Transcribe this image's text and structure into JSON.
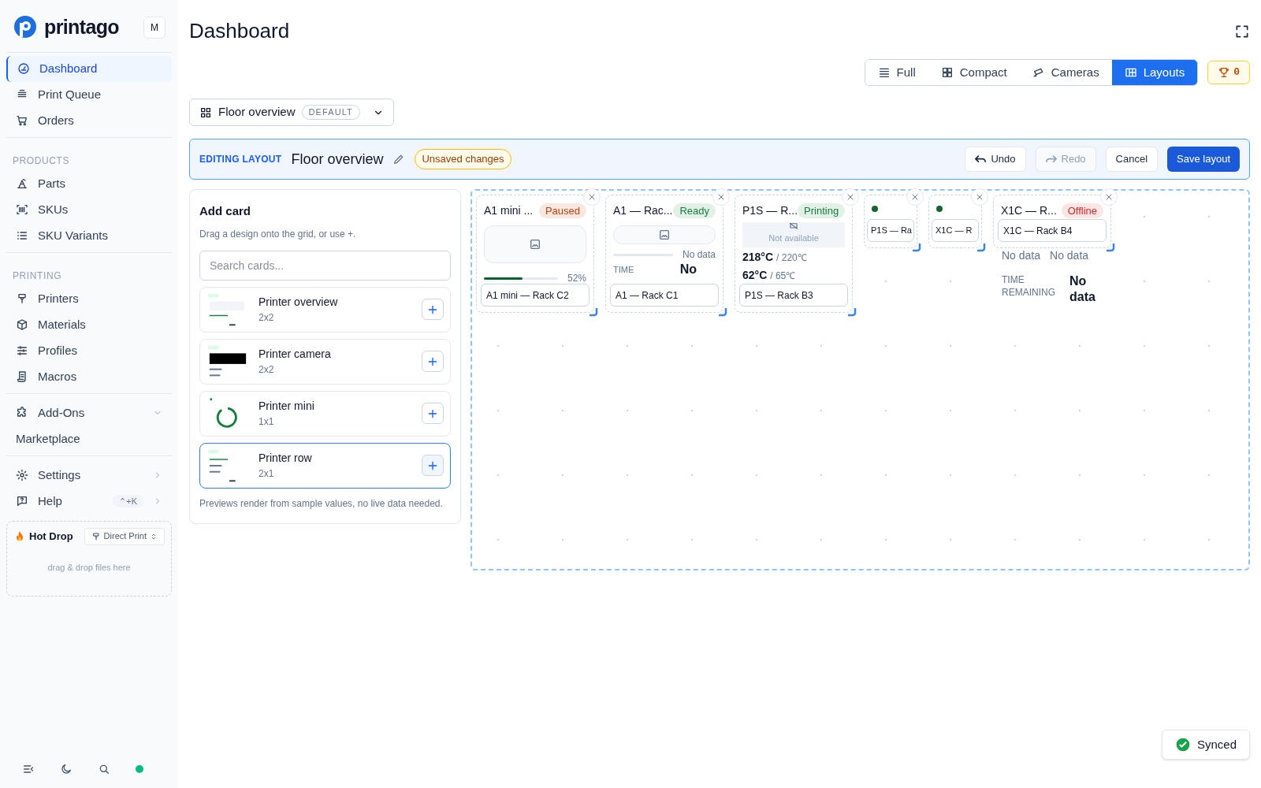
{
  "sidebar": {
    "brand": "printago",
    "avatar": "M",
    "sections": [
      {
        "items": [
          {
            "label": "Dashboard",
            "selected": true
          },
          {
            "label": "Print Queue",
            "selected": false
          },
          {
            "label": "Orders",
            "selected": false
          }
        ]
      },
      {
        "header": "PRODUCTS",
        "items": [
          {
            "label": "Parts",
            "selected": false
          },
          {
            "label": "SKUs",
            "selected": false
          },
          {
            "label": "SKU Variants",
            "selected": false
          }
        ]
      },
      {
        "header": "PRINTING",
        "items": [
          {
            "label": "Printers",
            "selected": false
          },
          {
            "label": "Materials",
            "selected": false
          },
          {
            "label": "Profiles",
            "selected": false
          },
          {
            "label": "Macros",
            "selected": false
          }
        ]
      },
      {
        "items": [
          {
            "label": "Add-Ons",
            "selected": false,
            "expanded": false
          },
          {
            "label": "Marketplace",
            "selected": false
          }
        ]
      },
      {
        "items": [
          {
            "label": "Settings",
            "selected": false
          },
          {
            "label": "Help",
            "selected": false,
            "shortcut": "⌃+K"
          }
        ]
      }
    ],
    "hot_drop": {
      "title": "Hot Drop",
      "mode": "Direct Print",
      "hint": "drag & drop files here"
    }
  },
  "page_title": "Dashboard",
  "view_tabs": [
    {
      "label": "Full",
      "selected": false
    },
    {
      "label": "Compact",
      "selected": false
    },
    {
      "label": "Cameras",
      "selected": false
    },
    {
      "label": "Layouts",
      "selected": true
    }
  ],
  "trophy_count": "0",
  "layout_select": {
    "name": "Floor overview",
    "badge": "DEFAULT"
  },
  "edit_bar": {
    "label": "EDITING LAYOUT",
    "name": "Floor overview",
    "status": "Unsaved changes",
    "buttons": [
      {
        "label": "Undo",
        "disabled": false
      },
      {
        "label": "Redo",
        "disabled": true
      },
      {
        "label": "Cancel",
        "disabled": false
      },
      {
        "label": "Save layout",
        "disabled": false
      }
    ]
  },
  "add_card": {
    "title": "Add card",
    "hint": "Drag a design onto the grid, or use +.",
    "search_placeholder": "Search cards...",
    "designs": [
      {
        "name": "Printer overview",
        "size": "2x2",
        "selected": false
      },
      {
        "name": "Printer camera",
        "size": "2x2",
        "selected": false
      },
      {
        "name": "Printer mini",
        "size": "1x1",
        "selected": false
      },
      {
        "name": "Printer row",
        "size": "2x1",
        "selected": true
      }
    ],
    "footer": "Previews render from sample values, no live data needed."
  },
  "canvas_cards": [
    {
      "kind": "overview",
      "title": "A1 mini ...",
      "status": "Paused",
      "color": "#c2410c",
      "level": 0.52,
      "reading": "52%",
      "name": "A1 mini — Rack C2"
    },
    {
      "kind": "overview",
      "title": "A1 — Rac...",
      "status": "Ready",
      "color": "#15803d",
      "reading": "No data",
      "time_label": "TIME",
      "time_value": "No",
      "name": "A1 — Rack C1"
    },
    {
      "kind": "camera",
      "title": "P1S — R...",
      "status": "Printing",
      "color": "#16803c",
      "camera_text": "Not available",
      "temps": [
        {
          "value": "218°C",
          "target": "/ 220℃"
        },
        {
          "value": "62°C",
          "target": "/ 65℃"
        }
      ],
      "name": "P1S — Rack B3"
    },
    {
      "kind": "mini",
      "color": "#166534",
      "name": "P1S — Ra"
    },
    {
      "kind": "mini",
      "color": "#166534",
      "name": "X1C — R"
    },
    {
      "kind": "row",
      "title": "X1C — R...",
      "status": "Offline",
      "color": "#dc2626",
      "name": "X1C — Rack B4",
      "values": [
        "No data",
        "No data"
      ],
      "time_label": "TIME REMAINING",
      "time_value": "No data"
    }
  ],
  "toast": "Synced"
}
